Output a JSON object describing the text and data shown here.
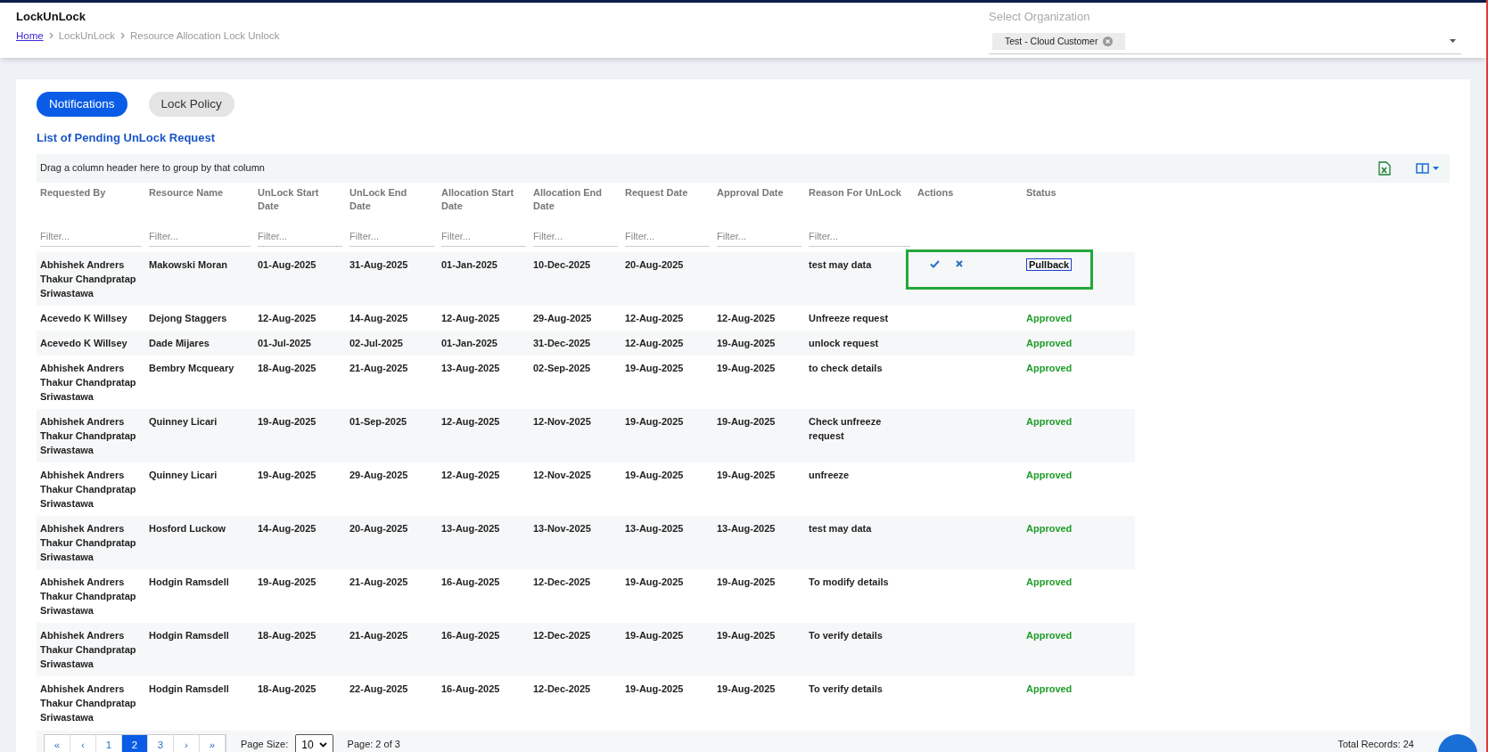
{
  "header": {
    "title": "LockUnLock",
    "breadcrumbs": [
      {
        "label": "Home",
        "link": true
      },
      {
        "label": "LockUnLock",
        "link": false
      },
      {
        "label": "Resource Allocation Lock Unlock",
        "link": false
      }
    ],
    "organization": {
      "label": "Select Organization",
      "chip": "Test - Cloud Customer"
    }
  },
  "tabs": [
    {
      "label": "Notifications",
      "selected": true
    },
    {
      "label": "Lock Policy",
      "selected": false
    }
  ],
  "section_title": "List of Pending UnLock Request",
  "group_hint": "Drag a column header here to group by that column",
  "columns": [
    "Requested By",
    "Resource Name",
    "UnLock Start Date",
    "UnLock End Date",
    "Allocation Start Date",
    "Allocation End Date",
    "Request Date",
    "Approval Date",
    "Reason For UnLock",
    "Actions",
    "Status"
  ],
  "filters": [
    {
      "placeholder": "Filter..."
    },
    {
      "placeholder": "Filter..."
    },
    {
      "placeholder": "Filter..."
    },
    {
      "placeholder": "Filter..."
    },
    {
      "placeholder": "Filter..."
    },
    {
      "placeholder": "Filter..."
    },
    {
      "placeholder": "Filter..."
    },
    {
      "placeholder": "Filter..."
    },
    {
      "placeholder": "Filter..."
    }
  ],
  "rows": [
    {
      "requested_by": "Abhishek Andrers Thakur Chandpratap Sriwastawa",
      "resource": "Makowski Moran",
      "unlock_start": "01-Aug-2025",
      "unlock_end": "31-Aug-2025",
      "alloc_start": "01-Jan-2025",
      "alloc_end": "10-Dec-2025",
      "request_date": "20-Aug-2025",
      "approval_date": "",
      "reason": "test may data",
      "actions": true,
      "status": "Pullback",
      "kind": "pullback",
      "highlighted": true
    },
    {
      "requested_by": "Acevedo K Willsey",
      "resource": "Dejong Staggers",
      "unlock_start": "12-Aug-2025",
      "unlock_end": "14-Aug-2025",
      "alloc_start": "12-Aug-2025",
      "alloc_end": "29-Aug-2025",
      "request_date": "12-Aug-2025",
      "approval_date": "12-Aug-2025",
      "reason": "Unfreeze request",
      "actions": false,
      "status": "Approved",
      "kind": "approved",
      "highlighted": false
    },
    {
      "requested_by": "Acevedo K Willsey",
      "resource": "Dade Mijares",
      "unlock_start": "01-Jul-2025",
      "unlock_end": "02-Jul-2025",
      "alloc_start": "01-Jan-2025",
      "alloc_end": "31-Dec-2025",
      "request_date": "12-Aug-2025",
      "approval_date": "19-Aug-2025",
      "reason": "unlock request",
      "actions": false,
      "status": "Approved",
      "kind": "approved",
      "highlighted": false
    },
    {
      "requested_by": "Abhishek Andrers Thakur Chandpratap Sriwastawa",
      "resource": "Bembry Mcqueary",
      "unlock_start": "18-Aug-2025",
      "unlock_end": "21-Aug-2025",
      "alloc_start": "13-Aug-2025",
      "alloc_end": "02-Sep-2025",
      "request_date": "19-Aug-2025",
      "approval_date": "19-Aug-2025",
      "reason": "to check details",
      "actions": false,
      "status": "Approved",
      "kind": "approved",
      "highlighted": false
    },
    {
      "requested_by": "Abhishek Andrers Thakur Chandpratap Sriwastawa",
      "resource": "Quinney Licari",
      "unlock_start": "19-Aug-2025",
      "unlock_end": "01-Sep-2025",
      "alloc_start": "12-Aug-2025",
      "alloc_end": "12-Nov-2025",
      "request_date": "19-Aug-2025",
      "approval_date": "19-Aug-2025",
      "reason": "Check unfreeze request",
      "actions": false,
      "status": "Approved",
      "kind": "approved",
      "highlighted": false
    },
    {
      "requested_by": "Abhishek Andrers Thakur Chandpratap Sriwastawa",
      "resource": "Quinney Licari",
      "unlock_start": "19-Aug-2025",
      "unlock_end": "29-Aug-2025",
      "alloc_start": "12-Aug-2025",
      "alloc_end": "12-Nov-2025",
      "request_date": "19-Aug-2025",
      "approval_date": "19-Aug-2025",
      "reason": "unfreeze",
      "actions": false,
      "status": "Approved",
      "kind": "approved",
      "highlighted": false
    },
    {
      "requested_by": "Abhishek Andrers Thakur Chandpratap Sriwastawa",
      "resource": "Hosford Luckow",
      "unlock_start": "14-Aug-2025",
      "unlock_end": "20-Aug-2025",
      "alloc_start": "13-Aug-2025",
      "alloc_end": "13-Nov-2025",
      "request_date": "13-Aug-2025",
      "approval_date": "13-Aug-2025",
      "reason": "test may data",
      "actions": false,
      "status": "Approved",
      "kind": "approved",
      "highlighted": false
    },
    {
      "requested_by": "Abhishek Andrers Thakur Chandpratap Sriwastawa",
      "resource": "Hodgin Ramsdell",
      "unlock_start": "19-Aug-2025",
      "unlock_end": "21-Aug-2025",
      "alloc_start": "16-Aug-2025",
      "alloc_end": "12-Dec-2025",
      "request_date": "19-Aug-2025",
      "approval_date": "19-Aug-2025",
      "reason": "To modify details",
      "actions": false,
      "status": "Approved",
      "kind": "approved",
      "highlighted": false
    },
    {
      "requested_by": "Abhishek Andrers Thakur Chandpratap Sriwastawa",
      "resource": "Hodgin Ramsdell",
      "unlock_start": "18-Aug-2025",
      "unlock_end": "21-Aug-2025",
      "alloc_start": "16-Aug-2025",
      "alloc_end": "12-Dec-2025",
      "request_date": "19-Aug-2025",
      "approval_date": "19-Aug-2025",
      "reason": "To verify details",
      "actions": false,
      "status": "Approved",
      "kind": "approved",
      "highlighted": false
    },
    {
      "requested_by": "Abhishek Andrers Thakur Chandpratap Sriwastawa",
      "resource": "Hodgin Ramsdell",
      "unlock_start": "18-Aug-2025",
      "unlock_end": "22-Aug-2025",
      "alloc_start": "16-Aug-2025",
      "alloc_end": "12-Dec-2025",
      "request_date": "19-Aug-2025",
      "approval_date": "19-Aug-2025",
      "reason": "To verify details",
      "actions": false,
      "status": "Approved",
      "kind": "approved",
      "highlighted": false
    }
  ],
  "pagination": {
    "pages": [
      {
        "label": "«",
        "selected": false
      },
      {
        "label": "‹",
        "selected": false
      },
      {
        "label": "1",
        "selected": false
      },
      {
        "label": "2",
        "selected": true
      },
      {
        "label": "3",
        "selected": false
      },
      {
        "label": "›",
        "selected": false
      },
      {
        "label": "»",
        "selected": false
      }
    ],
    "page_size_label": "Page Size:",
    "page_size": "10",
    "page_info": "Page: 2 of 3",
    "total": "Total Records: 24"
  }
}
